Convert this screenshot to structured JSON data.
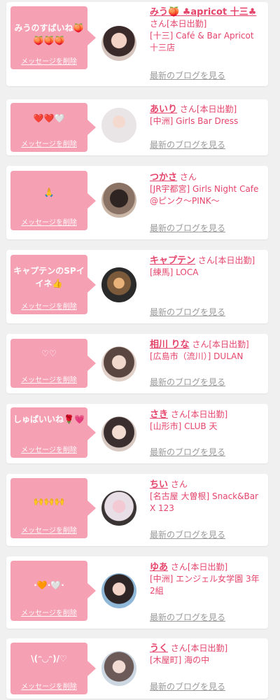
{
  "colors": {
    "accent": "#e5446b",
    "bubble": "#f6a0b3",
    "link_gray": "#9a9a9a"
  },
  "delete_label": "メッセージを削除",
  "blog_label": "最新のブログを見る",
  "entries": [
    {
      "message": "みうのすばいね🍑🍑🍑🍑",
      "name": "みう🍑 ♣apricot 十三♣",
      "suffix": "さん[本日出勤]",
      "shop": "[十三] Café & Bar Apricot 十三店"
    },
    {
      "message": "❤️❤️🤍",
      "name": "あいり",
      "suffix": "さん[本日出勤]",
      "shop": "[中洲] Girls Bar Dress"
    },
    {
      "message": "🙏",
      "name": "つかさ",
      "suffix": "さん",
      "shop": "[JR宇都宮] Girls Night Cafe @ピンク〜PINK〜"
    },
    {
      "message": "キャプテンのSPイイネ👍",
      "name": "キャプテン",
      "suffix": "さん[本日出勤]",
      "shop": "[練馬] LOCA"
    },
    {
      "message": "♡♡",
      "name": "相川 りな",
      "suffix": "さん[本日出勤]",
      "shop": "[広島市（流川）] DULAN"
    },
    {
      "message": "しゅぱいいね🌹💗",
      "name": "さき",
      "suffix": "さん[本日出勤]",
      "shop": "[山形市] CLUB 天"
    },
    {
      "message": "🙌🙌🙌",
      "name": "ちい",
      "suffix": "さん",
      "shop": "[名古屋 大曽根] Snack&Bar X 123"
    },
    {
      "message": "·🧡·🤍·",
      "name": "ゆあ",
      "suffix": "さん[本日出勤]",
      "shop": "[中洲] エンジェル女学園 3年2組"
    },
    {
      "message": "\\(ᵔ◡ᵔ)/♡",
      "name": "うく",
      "suffix": "さん[本日出勤]",
      "shop": "[木屋町] 海の中"
    }
  ]
}
